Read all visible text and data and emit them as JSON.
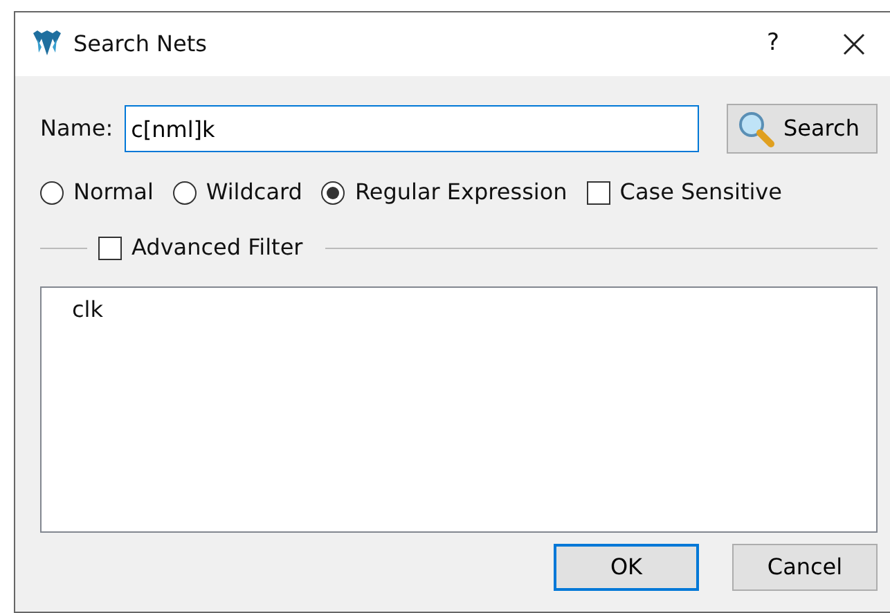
{
  "window": {
    "title": "Search Nets",
    "help": "?"
  },
  "name_field": {
    "label": "Name:",
    "value": "c[nml]k"
  },
  "search_button": {
    "label": "Search"
  },
  "options": [
    {
      "kind": "radio",
      "label": "Normal",
      "selected": false
    },
    {
      "kind": "radio",
      "label": "Wildcard",
      "selected": false
    },
    {
      "kind": "radio",
      "label": "Regular Expression",
      "selected": true
    },
    {
      "kind": "checkbox",
      "label": "Case Sensitive",
      "checked": false
    }
  ],
  "advanced_filter": {
    "label": "Advanced Filter",
    "checked": false
  },
  "results": [
    "clk"
  ],
  "buttons": [
    {
      "label": "OK",
      "default": true
    },
    {
      "label": "Cancel",
      "default": false
    }
  ]
}
